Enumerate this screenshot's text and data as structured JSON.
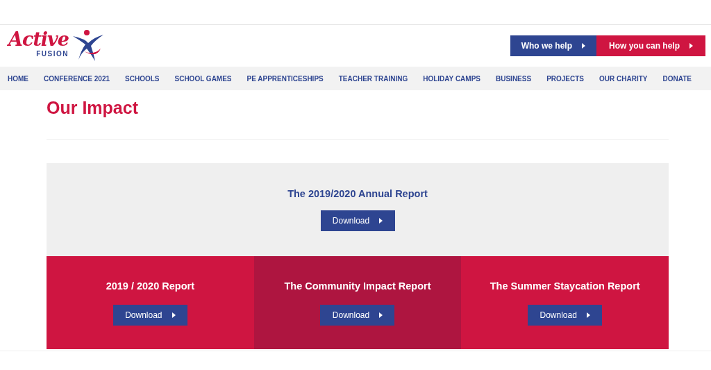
{
  "logo": {
    "word": "Active",
    "subword": "FUSION"
  },
  "header_buttons": [
    {
      "label": "Who we help",
      "color": "#2e4591"
    },
    {
      "label": "How you can help",
      "color": "#cf1541"
    }
  ],
  "nav": [
    "HOME",
    "CONFERENCE 2021",
    "SCHOOLS",
    "SCHOOL GAMES",
    "PE APPRENTICESHIPS",
    "TEACHER TRAINING",
    "HOLIDAY CAMPS",
    "BUSINESS",
    "PROJECTS",
    "OUR CHARITY",
    "DONATE"
  ],
  "page_title": "Our Impact",
  "featured": {
    "title": "The 2019/2020 Annual Report",
    "button": "Download"
  },
  "reports": [
    {
      "title": "2019 / 2020 Report",
      "button": "Download",
      "color": "#cf1541"
    },
    {
      "title": "The Community Impact Report",
      "button": "Download",
      "color": "#ae1540"
    },
    {
      "title": "The Summer Staycation Report",
      "button": "Download",
      "color": "#cf1541"
    }
  ]
}
